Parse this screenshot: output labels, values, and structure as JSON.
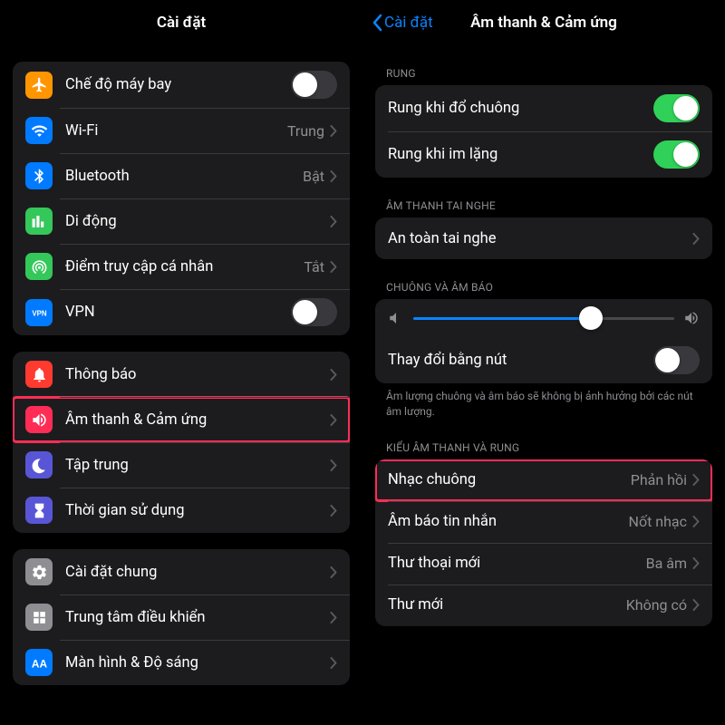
{
  "leftPanel": {
    "title": "Cài đặt",
    "group1": [
      {
        "icon": "airplane",
        "label": "Chế độ máy bay",
        "control": "toggle",
        "on": false,
        "iconBg": "#ff9500"
      },
      {
        "icon": "wifi",
        "label": "Wi-Fi",
        "value": "Trung",
        "control": "chevron",
        "iconBg": "#007aff"
      },
      {
        "icon": "bluetooth",
        "label": "Bluetooth",
        "value": "Bật",
        "control": "chevron",
        "iconBg": "#007aff"
      },
      {
        "icon": "cellular",
        "label": "Di động",
        "control": "chevron",
        "iconBg": "#34c759"
      },
      {
        "icon": "hotspot",
        "label": "Điểm truy cập cá nhân",
        "value": "Tắt",
        "control": "chevron",
        "iconBg": "#34c759"
      },
      {
        "icon": "vpn",
        "label": "VPN",
        "control": "toggle",
        "on": false,
        "iconBg": "#007aff"
      }
    ],
    "group2": [
      {
        "icon": "notifications",
        "label": "Thông báo",
        "control": "chevron",
        "iconBg": "#ff3b30"
      },
      {
        "icon": "sounds",
        "label": "Âm thanh & Cảm ứng",
        "control": "chevron",
        "iconBg": "#ff2d55",
        "highlight": true
      },
      {
        "icon": "focus",
        "label": "Tập trung",
        "control": "chevron",
        "iconBg": "#5856d6"
      },
      {
        "icon": "screentime",
        "label": "Thời gian sử dụng",
        "control": "chevron",
        "iconBg": "#5856d6"
      }
    ],
    "group3": [
      {
        "icon": "general",
        "label": "Cài đặt chung",
        "control": "chevron",
        "iconBg": "#8e8e93"
      },
      {
        "icon": "controlcenter",
        "label": "Trung tâm điều khiển",
        "control": "chevron",
        "iconBg": "#8e8e93"
      },
      {
        "icon": "display",
        "label": "Màn hình & Độ sáng",
        "control": "chevron",
        "iconBg": "#007aff"
      }
    ]
  },
  "rightPanel": {
    "backLabel": "Cài đặt",
    "title": "Âm thanh & Cảm ứng",
    "sections": {
      "rung": {
        "header": "RUNG",
        "items": [
          {
            "label": "Rung khi đổ chuông",
            "control": "toggle",
            "on": true
          },
          {
            "label": "Rung khi im lặng",
            "control": "toggle",
            "on": true
          }
        ]
      },
      "headphone": {
        "header": "ÂM THANH TAI NGHE",
        "items": [
          {
            "label": "An toàn tai nghe",
            "control": "chevron"
          }
        ]
      },
      "ringer": {
        "header": "CHUÔNG VÀ ÂM BÁO",
        "sliderPercent": 68,
        "changeWithButtons": {
          "label": "Thay đổi bằng nút",
          "on": false
        },
        "footer": "Âm lượng chuông và âm báo sẽ không bị ảnh hưởng bởi các nút âm lượng."
      },
      "patterns": {
        "header": "KIỂU ÂM THANH VÀ RUNG",
        "items": [
          {
            "label": "Nhạc chuông",
            "value": "Phản hồi",
            "control": "chevron",
            "highlight": true
          },
          {
            "label": "Âm báo tin nhắn",
            "value": "Nốt nhạc",
            "control": "chevron"
          },
          {
            "label": "Thư thoại mới",
            "value": "Ba âm",
            "control": "chevron"
          },
          {
            "label": "Thư mới",
            "value": "Không có",
            "control": "chevron"
          }
        ]
      }
    }
  }
}
